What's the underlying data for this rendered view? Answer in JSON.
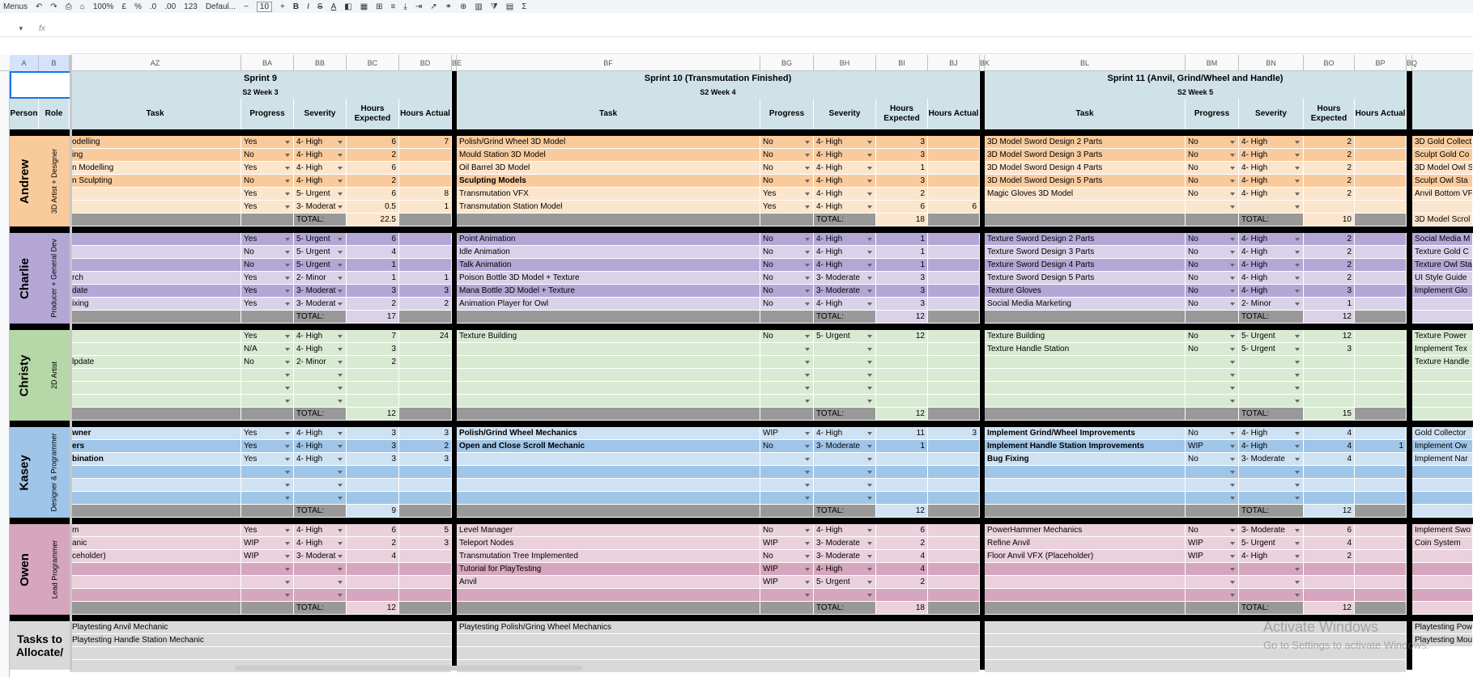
{
  "toolbar": {
    "menus": "Menus",
    "zoom": "100%",
    "currency": "£",
    "percent": "%",
    "dec_down": ".0",
    "dec_up": ".00",
    "number_format": "123",
    "font": "Defaul...",
    "font_size": "10",
    "bold": "B",
    "italic": "I",
    "strike": "S",
    "text_color": "A",
    "sum": "Σ"
  },
  "formula": {
    "fx": "fx"
  },
  "columns": [
    {
      "label": "A"
    },
    {
      "label": "B"
    },
    {
      "label": "AZ"
    },
    {
      "label": "BA"
    },
    {
      "label": "BB"
    },
    {
      "label": "BC"
    },
    {
      "label": "BD"
    },
    {
      "label": "BE"
    },
    {
      "label": "BF"
    },
    {
      "label": "BG"
    },
    {
      "label": "BH"
    },
    {
      "label": "BI"
    },
    {
      "label": "BJ"
    },
    {
      "label": "BK"
    },
    {
      "label": "BL"
    },
    {
      "label": "BM"
    },
    {
      "label": "BN"
    },
    {
      "label": "BO"
    },
    {
      "label": "BP"
    },
    {
      "label": "BQ"
    }
  ],
  "hdr": {
    "person": "Person",
    "role": "Role",
    "task": "Task",
    "progress": "Progress",
    "severity": "Severity",
    "hexp": "Hours Expected",
    "hact": "Hours Actual",
    "total": "TOTAL:"
  },
  "sprints": [
    {
      "title": "Sprint 9",
      "week": "S2 Week 3"
    },
    {
      "title": "Sprint 10 (Transmutation Finished)",
      "week": "S2 Week 4"
    },
    {
      "title": "Sprint 11 (Anvil, Grind/Wheel and Handle)",
      "week": "S2 Week 5"
    }
  ],
  "colors": {
    "andrew_light": "#fce5cd",
    "andrew_dark": "#f9cb9c",
    "charlie_light": "#d9d2e9",
    "charlie_dark": "#b4a7d6",
    "christy_light": "#d9ead3",
    "christy_dark": "#b6d7a8",
    "kasey_light": "#cfe2f3",
    "kasey_dark": "#9fc5e8",
    "owen_light": "#ead1dc",
    "owen_dark": "#d5a6bd",
    "header": "#cfe2e8",
    "total_row": "#999999",
    "black": "#000000"
  },
  "people": [
    {
      "name": "Andrew",
      "role": "3D Artist + Designer",
      "light": "#fce5cd",
      "dark": "#f9cb9c",
      "rows": [
        {
          "dark": true,
          "s": [
            [
              "odelling",
              "Yes",
              "4- High",
              "6",
              "7"
            ],
            [
              "Polish/Grind Wheel 3D Model",
              "No",
              "4- High",
              "3",
              ""
            ],
            [
              "3D Model Sword Design 2 Parts",
              "No",
              "4- High",
              "2",
              ""
            ]
          ],
          "e": "3D Gold Collect"
        },
        {
          "dark": true,
          "s": [
            [
              "ing",
              "No",
              "4- High",
              "2",
              ""
            ],
            [
              "Mould Station 3D Model",
              "No",
              "4- High",
              "3",
              ""
            ],
            [
              "3D Model Sword Design 3 Parts",
              "No",
              "4- High",
              "2",
              ""
            ]
          ],
          "e": "Sculpt Gold Co"
        },
        {
          "dark": false,
          "s": [
            [
              "n Modelling",
              "Yes",
              "4- High",
              "6",
              ""
            ],
            [
              "Oil Barrel 3D Model",
              "No",
              "4- High",
              "1",
              ""
            ],
            [
              "3D Model Sword Design 4 Parts",
              "No",
              "4- High",
              "2",
              ""
            ]
          ],
          "e": "3D Model Owl S"
        },
        {
          "dark": true,
          "s": [
            [
              "n Sculpting",
              "No",
              "4- High",
              "2",
              ""
            ],
            [
              "Sculpting Models",
              "No",
              "4- High",
              "3",
              ""
            ],
            [
              "3D Model Sword Design 5 Parts",
              "No",
              "4- High",
              "2",
              ""
            ]
          ],
          "e": "Sculpt Owl Sta",
          "b1": true
        },
        {
          "dark": false,
          "s": [
            [
              "",
              "Yes",
              "5- Urgent",
              "6",
              "8"
            ],
            [
              "Transmutation VFX",
              "Yes",
              "4- High",
              "2",
              ""
            ],
            [
              "Magic Gloves 3D Model",
              "No",
              "4- High",
              "2",
              ""
            ]
          ],
          "e": "Anvil Bottom VF"
        },
        {
          "dark": false,
          "s": [
            [
              "",
              "Yes",
              "3- Moderat",
              "0.5",
              "1"
            ],
            [
              "Transmutation Station Model",
              "Yes",
              "4- High",
              "6",
              "6"
            ],
            [
              "",
              "",
              "",
              "",
              ""
            ]
          ],
          "e": ""
        }
      ],
      "totals": [
        "22.5",
        "18",
        "10"
      ],
      "total_extra": "3D Model Scrol"
    },
    {
      "name": "Charlie",
      "role": "Producer + General Dev",
      "light": "#d9d2e9",
      "dark": "#b4a7d6",
      "rows": [
        {
          "dark": true,
          "s": [
            [
              "",
              "Yes",
              "5- Urgent",
              "6",
              ""
            ],
            [
              "Point Animation",
              "No",
              "4- High",
              "1",
              ""
            ],
            [
              "Texture Sword Design 2 Parts",
              "No",
              "4- High",
              "2",
              ""
            ]
          ],
          "e": "Social Media M"
        },
        {
          "dark": false,
          "s": [
            [
              "",
              "No",
              "5- Urgent",
              "4",
              ""
            ],
            [
              "Idle Animation",
              "No",
              "4- High",
              "1",
              ""
            ],
            [
              "Texture Sword Design 3 Parts",
              "No",
              "4- High",
              "2",
              ""
            ]
          ],
          "e": "Texture Gold C"
        },
        {
          "dark": true,
          "s": [
            [
              "",
              "No",
              "5- Urgent",
              "1",
              ""
            ],
            [
              "Talk Animation",
              "No",
              "4- High",
              "1",
              ""
            ],
            [
              "Texture Sword Design 4 Parts",
              "No",
              "4- High",
              "2",
              ""
            ]
          ],
          "e": "Texture Owl Sta"
        },
        {
          "dark": false,
          "s": [
            [
              "rch",
              "Yes",
              "2- Minor",
              "1",
              "1"
            ],
            [
              "Poison Bottle 3D Model + Texture",
              "No",
              "3- Moderate",
              "3",
              ""
            ],
            [
              "Texture Sword Design 5 Parts",
              "No",
              "4- High",
              "2",
              ""
            ]
          ],
          "e": "UI Style Guide"
        },
        {
          "dark": true,
          "s": [
            [
              "date",
              "Yes",
              "3- Moderat",
              "3",
              "3"
            ],
            [
              "Mana Bottle 3D Model + Texture",
              "No",
              "3- Moderate",
              "3",
              ""
            ],
            [
              "Texture Gloves",
              "No",
              "4- High",
              "3",
              ""
            ]
          ],
          "e": "Implement Glo"
        },
        {
          "dark": false,
          "s": [
            [
              "ixing",
              "Yes",
              "3- Moderat",
              "2",
              "2"
            ],
            [
              "Animation Player for Owl",
              "No",
              "4- High",
              "3",
              ""
            ],
            [
              "Social Media Marketing",
              "No",
              "2- Minor",
              "1",
              ""
            ]
          ],
          "e": ""
        }
      ],
      "totals": [
        "17",
        "12",
        "12"
      ],
      "total_extra": ""
    },
    {
      "name": "Christy",
      "role": "2D Artist",
      "light": "#d9ead3",
      "dark": "#b6d7a8",
      "rows": [
        {
          "dark": false,
          "s": [
            [
              "",
              "Yes",
              "4- High",
              "7",
              "24"
            ],
            [
              "Texture Building",
              "No",
              "5- Urgent",
              "12",
              ""
            ],
            [
              "Texture Building",
              "No",
              "5- Urgent",
              "12",
              ""
            ]
          ],
          "e": "Texture Power"
        },
        {
          "dark": false,
          "s": [
            [
              "",
              "N/A",
              "4- High",
              "3",
              ""
            ],
            [
              "",
              "",
              "",
              "",
              ""
            ],
            [
              "Texture Handle Station",
              "No",
              "5- Urgent",
              "3",
              ""
            ]
          ],
          "e": "Implement Tex"
        },
        {
          "dark": false,
          "s": [
            [
              "lpdate",
              "No",
              "2- Minor",
              "2",
              ""
            ],
            [
              "",
              "",
              "",
              "",
              ""
            ],
            [
              "",
              "",
              "",
              "",
              ""
            ]
          ],
          "e": "Texture Handle"
        },
        {
          "dark": false,
          "s": [
            [
              "",
              "",
              "",
              "",
              ""
            ],
            [
              "",
              "",
              "",
              "",
              ""
            ],
            [
              "",
              "",
              "",
              "",
              ""
            ]
          ],
          "e": ""
        },
        {
          "dark": false,
          "s": [
            [
              "",
              "",
              "",
              "",
              ""
            ],
            [
              "",
              "",
              "",
              "",
              ""
            ],
            [
              "",
              "",
              "",
              "",
              ""
            ]
          ],
          "e": ""
        },
        {
          "dark": false,
          "s": [
            [
              "",
              "",
              "",
              "",
              ""
            ],
            [
              "",
              "",
              "",
              "",
              ""
            ],
            [
              "",
              "",
              "",
              "",
              ""
            ]
          ],
          "e": ""
        }
      ],
      "totals": [
        "12",
        "12",
        "15"
      ],
      "total_extra": ""
    },
    {
      "name": "Kasey",
      "role": "Designer & Programmer",
      "light": "#cfe2f3",
      "dark": "#9fc5e8",
      "rows": [
        {
          "dark": false,
          "bold": true,
          "s": [
            [
              "wner",
              "Yes",
              "4- High",
              "3",
              "3"
            ],
            [
              "Polish/Grind Wheel Mechanics",
              "WIP",
              "4- High",
              "11",
              "3"
            ],
            [
              "Implement Grind/Wheel Improvements",
              "No",
              "4- High",
              "4",
              ""
            ]
          ],
          "e": "Gold Collector"
        },
        {
          "dark": true,
          "bold": true,
          "s": [
            [
              "ers",
              "Yes",
              "4- High",
              "3",
              "2"
            ],
            [
              "Open and Close Scroll Mechanic",
              "No",
              "3- Moderate",
              "1",
              ""
            ],
            [
              "Implement Handle Station Improvements",
              "WIP",
              "4- High",
              "4",
              "1"
            ]
          ],
          "e": "Implement Ow",
          "b1": false
        },
        {
          "dark": false,
          "bold": true,
          "s": [
            [
              "bination",
              "Yes",
              "4- High",
              "3",
              "3"
            ],
            [
              "",
              "",
              "",
              "",
              ""
            ],
            [
              "Bug Fixing",
              "No",
              "3- Moderate",
              "4",
              ""
            ]
          ],
          "e": "Implement Nar"
        },
        {
          "dark": true,
          "s": [
            [
              "",
              "",
              "",
              "",
              ""
            ],
            [
              "",
              "",
              "",
              "",
              ""
            ],
            [
              "",
              "",
              "",
              "",
              ""
            ]
          ],
          "e": ""
        },
        {
          "dark": false,
          "s": [
            [
              "",
              "",
              "",
              "",
              ""
            ],
            [
              "",
              "",
              "",
              "",
              ""
            ],
            [
              "",
              "",
              "",
              "",
              ""
            ]
          ],
          "e": ""
        },
        {
          "dark": true,
          "s": [
            [
              "",
              "",
              "",
              "",
              ""
            ],
            [
              "",
              "",
              "",
              "",
              ""
            ],
            [
              "",
              "",
              "",
              "",
              ""
            ]
          ],
          "e": ""
        }
      ],
      "totals": [
        "9",
        "12",
        "12"
      ],
      "total_extra": ""
    },
    {
      "name": "Owen",
      "role": "Lead Programmer",
      "light": "#ead1dc",
      "dark": "#d5a6bd",
      "rows": [
        {
          "dark": false,
          "s": [
            [
              "m",
              "Yes",
              "4- High",
              "6",
              "5"
            ],
            [
              "Level Manager",
              "No",
              "4- High",
              "6",
              ""
            ],
            [
              "PowerHammer Mechanics",
              "No",
              "3- Moderate",
              "6",
              ""
            ]
          ],
          "e": "Implement Swo"
        },
        {
          "dark": false,
          "s": [
            [
              "anic",
              "WIP",
              "4- High",
              "2",
              "3"
            ],
            [
              "Teleport Nodes",
              "WIP",
              "3- Moderate",
              "2",
              ""
            ],
            [
              "Refine Anvil",
              "WIP",
              "5- Urgent",
              "4",
              ""
            ]
          ],
          "e": "Coin System"
        },
        {
          "dark": false,
          "s": [
            [
              "ceholder)",
              "WIP",
              "3- Moderat",
              "4",
              ""
            ],
            [
              "Transmutation Tree Implemented",
              "No",
              "3- Moderate",
              "4",
              ""
            ],
            [
              "Floor Anvil VFX (Placeholder)",
              "WIP",
              "4- High",
              "2",
              ""
            ]
          ],
          "e": ""
        },
        {
          "dark": true,
          "s": [
            [
              "",
              "",
              "",
              "",
              ""
            ],
            [
              "Tutorial for PlayTesting",
              "WIP",
              "4- High",
              "4",
              ""
            ],
            [
              "",
              "",
              "",
              "",
              ""
            ]
          ],
          "e": ""
        },
        {
          "dark": false,
          "s": [
            [
              "",
              "",
              "",
              "",
              ""
            ],
            [
              "Anvil",
              "WIP",
              "5- Urgent",
              "2",
              ""
            ],
            [
              "",
              "",
              "",
              "",
              ""
            ]
          ],
          "e": ""
        },
        {
          "dark": true,
          "s": [
            [
              "",
              "",
              "",
              "",
              ""
            ],
            [
              "",
              "",
              "",
              "",
              ""
            ],
            [
              "",
              "",
              "",
              "",
              ""
            ]
          ],
          "e": ""
        }
      ],
      "totals": [
        "12",
        "18",
        "12"
      ],
      "total_extra": ""
    }
  ],
  "allocate": {
    "label": "Tasks to Allocate/",
    "rows": [
      [
        "Playtesting Anvil Mechanic",
        "Playtesting Polish/Gring Wheel Mechanics",
        "Playtesting Pow"
      ],
      [
        "Playtesting Handle Station Mechanic",
        "",
        "Playtesting Mou"
      ]
    ]
  },
  "watermark": {
    "line1": "Activate Windows",
    "line2": "Go to Settings to activate Windows."
  }
}
